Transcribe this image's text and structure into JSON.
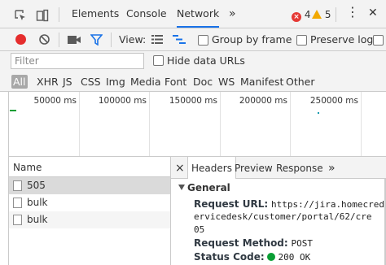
{
  "topbar": {
    "tabs": [
      {
        "label": "Elements"
      },
      {
        "label": "Console"
      },
      {
        "label": "Network"
      }
    ],
    "more": "»",
    "errors": {
      "icon": "×",
      "count": "4"
    },
    "warnings": {
      "count": "5"
    },
    "menu": "⋮",
    "close": "✕"
  },
  "toolbar": {
    "view_label": "View:",
    "group_by_frame": "Group by frame",
    "preserve_log": "Preserve log"
  },
  "filter": {
    "placeholder": "Filter",
    "hide_data_urls": "Hide data URLs"
  },
  "types": [
    "All",
    "XHR",
    "JS",
    "CSS",
    "Img",
    "Media",
    "Font",
    "Doc",
    "WS",
    "Manifest",
    "Other"
  ],
  "overview": {
    "ticks": [
      "50000 ms",
      "100000 ms",
      "150000 ms",
      "200000 ms",
      "250000 ms"
    ]
  },
  "list": {
    "header": "Name",
    "rows": [
      {
        "name": "505"
      },
      {
        "name": "bulk"
      },
      {
        "name": "bulk"
      }
    ]
  },
  "details": {
    "close": "×",
    "tabs": [
      {
        "label": "Headers"
      },
      {
        "label": "Preview"
      },
      {
        "label": "Response"
      }
    ],
    "more": "»",
    "general_label": "General",
    "request_url_label": "Request URL:",
    "request_url_line1": "https://jira.homecred",
    "request_url_line2": "ervicedesk/customer/portal/62/cre",
    "request_url_line3": "05",
    "request_method_label": "Request Method:",
    "request_method": "POST",
    "status_code_label": "Status Code:",
    "status_code": "200 OK"
  },
  "colors": {
    "accent": "#1a73e8",
    "record": "#e52d2d",
    "error": "#e53935",
    "warning": "#f2a900",
    "status_ok": "#0a9e35"
  }
}
